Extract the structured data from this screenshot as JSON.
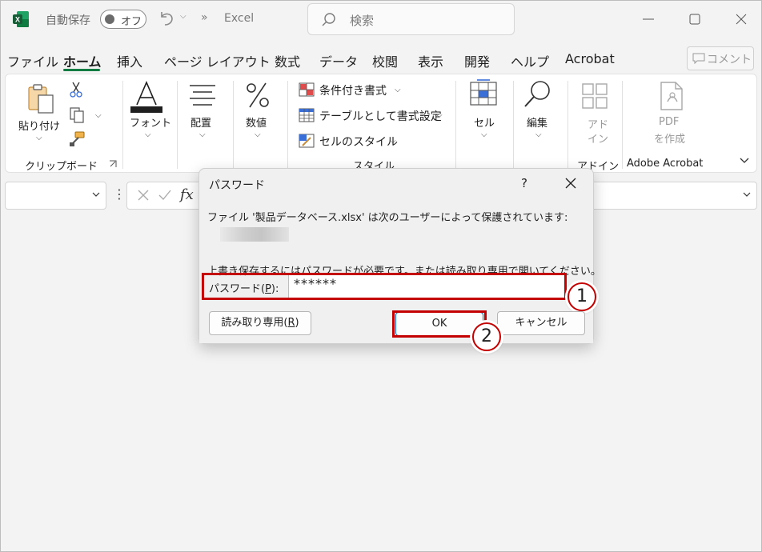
{
  "titlebar": {
    "autosave_label": "自動保存",
    "autosave_state": "オフ",
    "app_name": "Excel",
    "search_placeholder": "検索"
  },
  "menu": {
    "tabs": [
      "ファイル",
      "ホーム",
      "挿入",
      "ページ レイアウト",
      "数式",
      "データ",
      "校閲",
      "表示",
      "開発",
      "ヘルプ",
      "Acrobat"
    ],
    "active_tab": "ホーム",
    "comment_label": "コメント"
  },
  "ribbon": {
    "paste_label": "貼り付け",
    "clipboard_group": "クリップボード",
    "font_label": "フォント",
    "alignment_label": "配置",
    "number_label": "数値",
    "styles": {
      "conditional": "条件付き書式",
      "as_table": "テーブルとして書式設定",
      "cell_styles": "セルのスタイル",
      "group": "スタイル"
    },
    "cells_label": "セル",
    "editing_label": "編集",
    "addins_label_1": "アド",
    "addins_label_2": "イン",
    "addins_group": "アドイン",
    "pdf_label_1": "PDF",
    "pdf_label_2": "を作成",
    "acrobat_group": "Adobe Acrobat"
  },
  "formula_bar": {
    "fx_label": "fx"
  },
  "dialog": {
    "title": "パスワード",
    "help": "?",
    "message": "ファイル '製品データベース.xlsx' は次のユーザーによって保護されています:",
    "message2": "上書き保存するにはパスワードが必要です。または読み取り専用で開いてください。",
    "password_label_prefix": "パスワード(",
    "password_label_key": "P",
    "password_label_suffix": "):",
    "password_value": "******",
    "readonly_prefix": "読み取り専用(",
    "readonly_key": "R",
    "readonly_suffix": ")",
    "ok_label": "OK",
    "cancel_label": "キャンセル"
  },
  "markers": {
    "one": "1",
    "two": "2"
  },
  "colors": {
    "excel_green": "#107c41",
    "highlight_red": "#c40000"
  }
}
